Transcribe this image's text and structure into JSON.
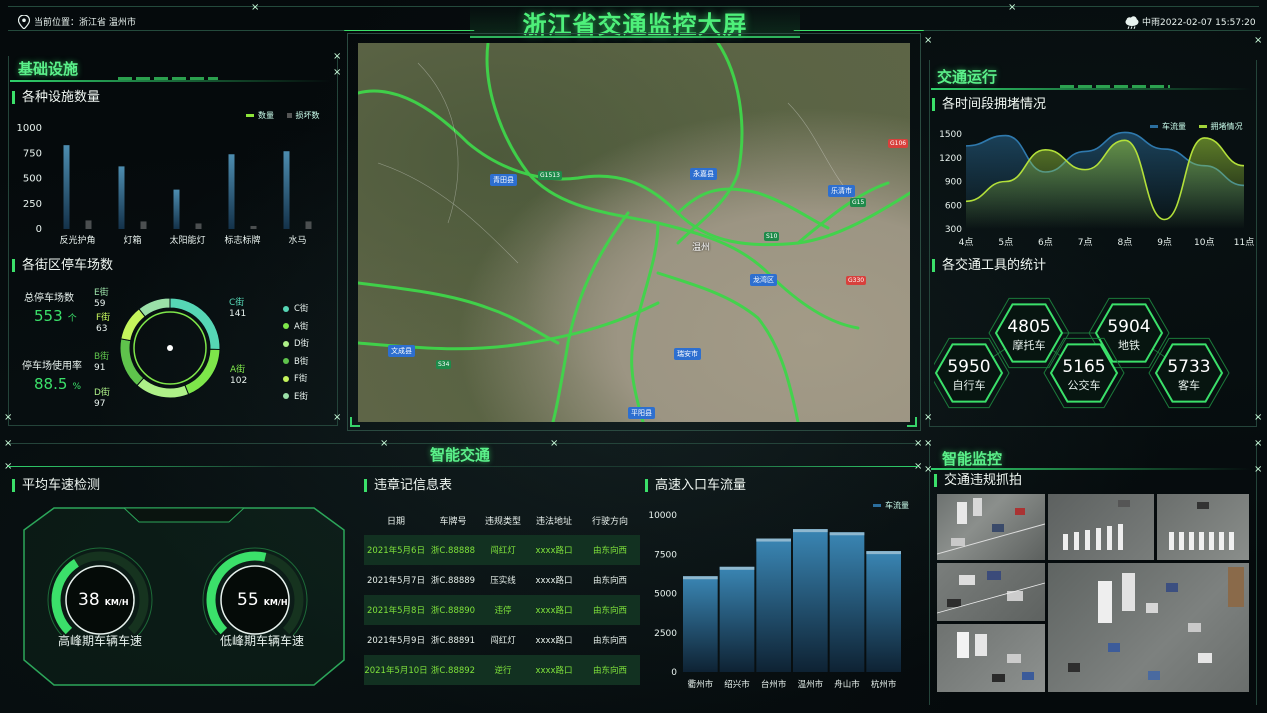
{
  "header": {
    "title": "浙江省交通监控大屏",
    "location_label": "当前位置：",
    "location_value": "浙江省 温州市",
    "weather": "中雨",
    "datetime": "2022-02-07 15:57:20"
  },
  "infra": {
    "section_title": "基础设施",
    "facility_title": "各种设施数量",
    "legend_count": "数量",
    "legend_damage": "损坏数",
    "parking_title": "各街区停车场数"
  },
  "parking": {
    "total_label": "总停车场数",
    "total_value": "553",
    "total_unit": "个",
    "rate_label": "停车场使用率",
    "rate_value": "88.5",
    "rate_unit": "%",
    "streets": [
      {
        "name": "E街",
        "value": "59"
      },
      {
        "name": "F街",
        "value": "63"
      },
      {
        "name": "B街",
        "value": "91"
      },
      {
        "name": "D街",
        "value": "97"
      },
      {
        "name": "C街",
        "value": "141"
      },
      {
        "name": "A街",
        "value": "102"
      }
    ],
    "legend": [
      "C街",
      "A街",
      "D街",
      "B街",
      "F街",
      "E街"
    ],
    "legend_colors": [
      "#56d6b5",
      "#7ee64a",
      "#aef088",
      "#5fc34c",
      "#c4f45c",
      "#9be0a8"
    ]
  },
  "traffic": {
    "section_title": "交通运行",
    "congestion_title": "各时间段拥堵情况",
    "legend_flow": "车流量",
    "legend_jam": "拥堵情况",
    "tools_title": "各交通工具的统计",
    "tools": [
      {
        "value": "4805",
        "label": "摩托车"
      },
      {
        "value": "5904",
        "label": "地铁"
      },
      {
        "value": "5950",
        "label": "自行车"
      },
      {
        "value": "5165",
        "label": "公交车"
      },
      {
        "value": "5733",
        "label": "客车"
      }
    ]
  },
  "smart": {
    "section_title": "智能交通",
    "speed_title": "平均车速检测",
    "peak_value": "38",
    "peak_unit": "KM/H",
    "peak_label": "高峰期车辆车速",
    "low_value": "55",
    "low_unit": "KM/H",
    "low_label": "低峰期车辆车速",
    "violations_title": "违章记信息表",
    "violation_headers": [
      "日期",
      "车牌号",
      "违规类型",
      "违法地址",
      "行驶方向"
    ],
    "violation_rows": [
      [
        "2021年5月6日",
        "浙C.88888",
        "闯红灯",
        "xxxx路口",
        "由东向西"
      ],
      [
        "2021年5月7日",
        "浙C.88889",
        "压实线",
        "xxxx路口",
        "由东向西"
      ],
      [
        "2021年5月8日",
        "浙C.88890",
        "违停",
        "xxxx路口",
        "由东向西"
      ],
      [
        "2021年5月9日",
        "浙C.88891",
        "闯红灯",
        "xxxx路口",
        "由东向西"
      ],
      [
        "2021年5月10日",
        "浙C.88892",
        "逆行",
        "xxxx路口",
        "由东向西"
      ]
    ],
    "highway_title": "高速入口车流量",
    "highway_legend": "车流量"
  },
  "monitor": {
    "section_title": "智能监控",
    "capture_title": "交通违规抓拍"
  },
  "map": {
    "labels": [
      "青田县",
      "永嘉县",
      "乐清市",
      "温州",
      "龙湾区",
      "文成县",
      "瑞安市",
      "平阳县",
      "G1513",
      "G15",
      "S10",
      "G106",
      "G330",
      "S34"
    ]
  },
  "colors": {
    "accent": "#3be06a",
    "lime": "#94f03c",
    "bar_blue": "#2f6d90"
  },
  "chart_data": [
    {
      "type": "bar",
      "title": "各种设施数量",
      "categories": [
        "反光护角",
        "灯箱",
        "太阳能灯",
        "标志标牌",
        "水马"
      ],
      "series": [
        {
          "name": "数量",
          "values": [
            830,
            620,
            390,
            740,
            770
          ]
        },
        {
          "name": "损坏数",
          "values": [
            85,
            75,
            55,
            30,
            75
          ]
        }
      ],
      "ylim": [
        0,
        1000
      ],
      "yticks": [
        0,
        250,
        500,
        750,
        1000
      ]
    },
    {
      "type": "pie",
      "title": "各街区停车场数",
      "labels": [
        "C街",
        "A街",
        "D街",
        "B街",
        "F街",
        "E街"
      ],
      "values": [
        141,
        102,
        97,
        91,
        63,
        59
      ]
    },
    {
      "type": "area",
      "title": "各时间段拥堵情况",
      "categories": [
        "4点",
        "5点",
        "6点",
        "7点",
        "8点",
        "9点",
        "10点",
        "11点"
      ],
      "series": [
        {
          "name": "车流量",
          "values": [
            1350,
            1480,
            1020,
            1280,
            1520,
            1310,
            1100,
            850
          ]
        },
        {
          "name": "拥堵情况",
          "values": [
            650,
            900,
            1300,
            1050,
            1420,
            420,
            1450,
            1100
          ]
        }
      ],
      "ylim": [
        300,
        1500
      ],
      "yticks": [
        300,
        600,
        900,
        1200,
        1500
      ]
    },
    {
      "type": "bar",
      "title": "高速入口车流量",
      "categories": [
        "衢州市",
        "绍兴市",
        "台州市",
        "温州市",
        "舟山市",
        "杭州市"
      ],
      "series": [
        {
          "name": "车流量",
          "values": [
            6100,
            6700,
            8500,
            9100,
            8900,
            7700
          ]
        }
      ],
      "ylim": [
        0,
        10000
      ],
      "yticks": [
        0,
        2500,
        5000,
        7500,
        10000
      ]
    }
  ]
}
